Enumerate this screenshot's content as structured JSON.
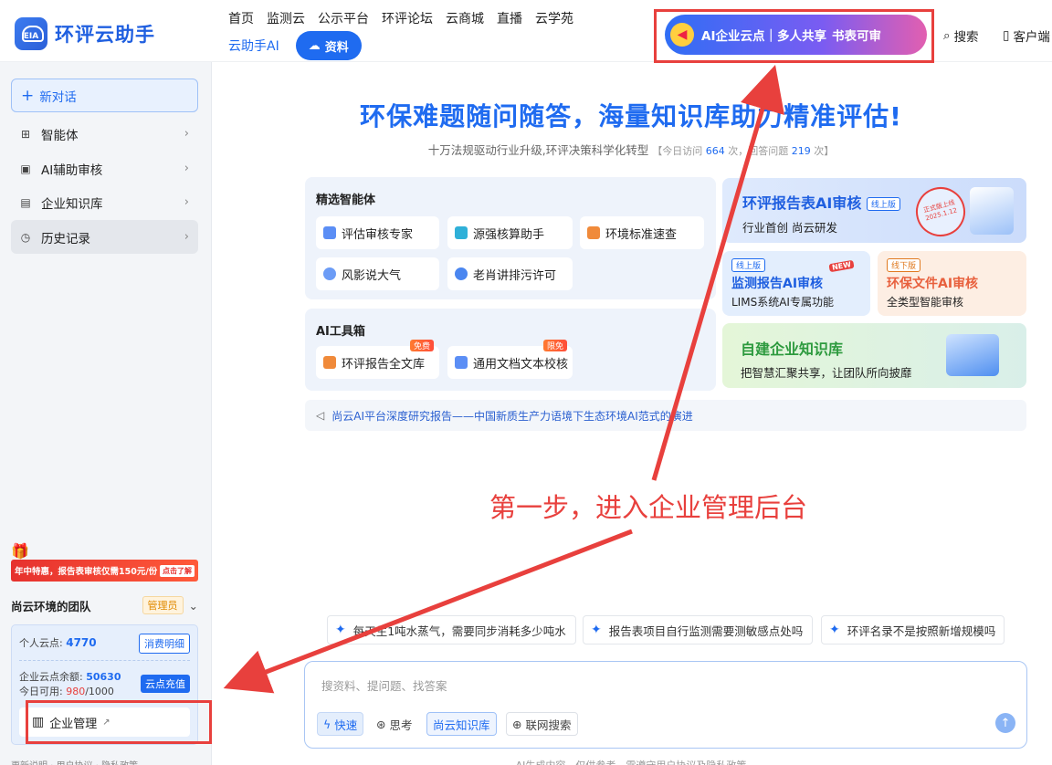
{
  "header": {
    "logo_badge": "EIA",
    "app_name": "环评云助手",
    "nav_top": [
      "首页",
      "监测云",
      "公示平台",
      "环评论坛",
      "云商城",
      "直播",
      "云学苑"
    ],
    "nav_second": "云助手AI",
    "ziliao_label": "资料",
    "ai_banner_text": "AI企业云点｜多人共享",
    "ai_banner_cta": "书表可审",
    "search_label": "搜索",
    "client_label": "客户端"
  },
  "sidebar": {
    "new_chat": "新对话",
    "items": [
      {
        "label": "智能体",
        "icon": "grid-icon"
      },
      {
        "label": "AI辅助审核",
        "icon": "ai-icon"
      },
      {
        "label": "企业知识库",
        "icon": "book-icon"
      },
      {
        "label": "历史记录",
        "icon": "clock-icon"
      }
    ],
    "promo_text": "年中特惠，报告表审核仅需150元/份",
    "promo_tag": "点击了解",
    "team_name": "尚云环境的团队",
    "team_role": "管理员",
    "personal_points_label": "个人云点:",
    "personal_points": "4770",
    "detail_button": "消费明细",
    "ent_balance_label": "企业云点余额:",
    "ent_balance": "50630",
    "today_label": "今日可用:",
    "today_used": "980",
    "today_total": "/1000",
    "recharge_button": "云点充值",
    "ent_mgmt": "企业管理",
    "footer": "更新说明 · 用户协议 · 隐私政策"
  },
  "main": {
    "hero_title": "环保难题随问随答，海量知识库助力精准评估!",
    "hero_sub": "十万法规驱动行业升级,环评决策科学化转型",
    "visits_prefix": "【今日访问",
    "visits": "664",
    "visits_mid": "次，回答问题",
    "answers": "219",
    "visits_suffix": "次】",
    "agents_title": "精选智能体",
    "agents": [
      "评估审核专家",
      "源强核算助手",
      "环境标准速查",
      "风影说大气",
      "老肖讲排污许可"
    ],
    "tools_title": "AI工具箱",
    "tools": [
      {
        "label": "环评报告全文库",
        "badge": "免费"
      },
      {
        "label": "通用文档文本校核",
        "badge": "限免"
      }
    ],
    "card1_title": "环评报告表AI审核",
    "card1_tag": "线上版",
    "card1_sub": "行业首创 尚云研发",
    "card1_stamp": "正式版上线 2025.1.12",
    "card2_tag": "线上版",
    "card2_title": "监测报告AI审核",
    "card2_new": "NEW",
    "card2_sub": "LIMS系统AI专属功能",
    "card3_tag": "线下版",
    "card3_title": "环保文件AI审核",
    "card3_sub": "全类型智能审核",
    "card4_title": "自建企业知识库",
    "card4_sub": "把智慧汇聚共享，让团队所向披靡",
    "notice": "尚云AI平台深度研究报告——中国新质生产力语境下生态环境AI范式的演进",
    "annotation": "第一步，进入企业管理后台",
    "suggestions": [
      "每天生1吨水蒸气，需要同步消耗多少吨水",
      "报告表项目自行监测需要测敏感点处吗",
      "环评名录不是按照新增规模吗"
    ],
    "input_placeholder": "搜资料、提问题、找答案",
    "chip_fast": "快速",
    "chip_think": "思考",
    "chip_kb": "尚云知识库",
    "chip_web": "联网搜索",
    "disclaimer": "AI生成内容，仅供参考，需遵守用户协议及隐私政策"
  },
  "colors": {
    "brand": "#1f6bf0",
    "annotation_red": "#e8403d"
  }
}
